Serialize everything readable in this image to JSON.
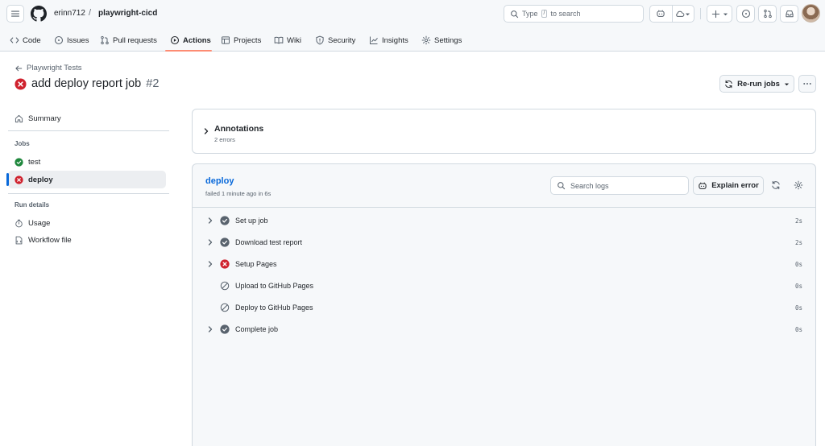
{
  "header": {
    "owner": "erinn712",
    "separator": "/",
    "repo": "playwright-cicd",
    "search_prefix": "Type",
    "search_key": "/",
    "search_suffix": "to search"
  },
  "tabs": [
    {
      "label": "Code",
      "icon": "code-icon"
    },
    {
      "label": "Issues",
      "icon": "issue-icon"
    },
    {
      "label": "Pull requests",
      "icon": "pull-request-icon"
    },
    {
      "label": "Actions",
      "icon": "play-icon",
      "active": true
    },
    {
      "label": "Projects",
      "icon": "table-icon"
    },
    {
      "label": "Wiki",
      "icon": "book-icon"
    },
    {
      "label": "Security",
      "icon": "shield-icon"
    },
    {
      "label": "Insights",
      "icon": "graph-icon"
    },
    {
      "label": "Settings",
      "icon": "gear-icon"
    }
  ],
  "run": {
    "back_label": "Playwright Tests",
    "title": "add deploy report job",
    "number": "#2",
    "rerun_label": "Re-run jobs"
  },
  "sidebar": {
    "summary_label": "Summary",
    "jobs_heading": "Jobs",
    "jobs": [
      {
        "label": "test",
        "status": "success"
      },
      {
        "label": "deploy",
        "status": "failure",
        "active": true
      }
    ],
    "run_details_heading": "Run details",
    "details": [
      {
        "label": "Usage",
        "icon": "stopwatch-icon"
      },
      {
        "label": "Workflow file",
        "icon": "file-icon"
      }
    ]
  },
  "annotations": {
    "title": "Annotations",
    "subtitle": "2 errors"
  },
  "job": {
    "name": "deploy",
    "status_text": "failed 1 minute ago in 6s",
    "search_placeholder": "Search logs",
    "explain_label": "Explain error",
    "steps": [
      {
        "name": "Set up job",
        "duration": "2s",
        "status": "success",
        "expandable": true
      },
      {
        "name": "Download test report",
        "duration": "2s",
        "status": "success",
        "expandable": true
      },
      {
        "name": "Setup Pages",
        "duration": "0s",
        "status": "failure",
        "expandable": true
      },
      {
        "name": "Upload to GitHub Pages",
        "duration": "0s",
        "status": "skipped",
        "expandable": false
      },
      {
        "name": "Deploy to GitHub Pages",
        "duration": "0s",
        "status": "skipped",
        "expandable": false
      },
      {
        "name": "Complete job",
        "duration": "0s",
        "status": "success",
        "expandable": true
      }
    ]
  },
  "colors": {
    "success": "#1f883d",
    "failure": "#cf222e",
    "step_success": "#59636e",
    "link": "#0969da",
    "tab_underline": "#fd8c73"
  }
}
